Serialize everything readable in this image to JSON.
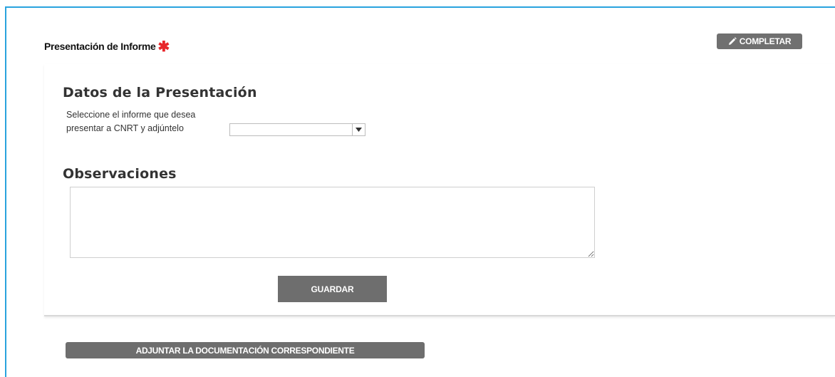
{
  "header": {
    "title": "Presentación de Informe",
    "required_mark": "✱",
    "completar_label": "COMPLETAR"
  },
  "presentation": {
    "section_title": "Datos de la Presentación",
    "select_label": "Seleccione el informe que desea presentar a CNRT y adjúntelo",
    "select_value": ""
  },
  "observations": {
    "section_title": "Observaciones",
    "value": ""
  },
  "actions": {
    "guardar_label": "GUARDAR",
    "adjuntar_label": "ADJUNTAR LA DOCUMENTACIÓN CORRESPONDIENTE"
  },
  "colors": {
    "frame_border": "#29a3de",
    "required_star": "#e8262a",
    "button_bg": "#6e6e6e"
  }
}
